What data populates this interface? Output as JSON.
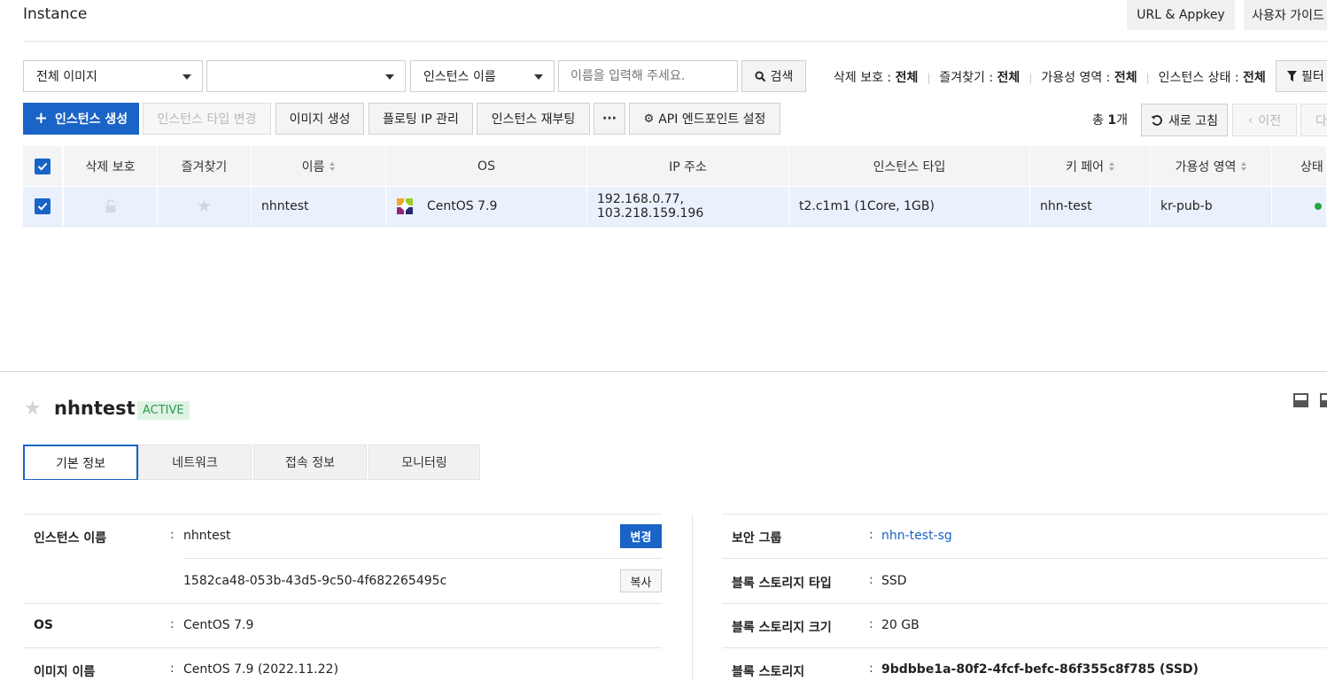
{
  "header": {
    "title": "Instance",
    "url_appkey": "URL & Appkey",
    "user_guide": "사용자 가이드"
  },
  "search": {
    "image_select": "전체 이미지",
    "second_select": "",
    "field_select": "인스턴스 이름",
    "placeholder": "이름을 입력해 주세요.",
    "search_button": "검색"
  },
  "filters": {
    "delete_protect_label": "삭제 보호 :",
    "delete_protect_value": "전체",
    "favorite_label": "즐겨찾기 :",
    "favorite_value": "전체",
    "zone_label": "가용성 영역 :",
    "zone_value": "전체",
    "state_label": "인스턴스 상태 :",
    "state_value": "전체",
    "filter_button": "필터"
  },
  "toolbar": {
    "create": "인스턴스 생성",
    "change_type": "인스턴스 타입 변경",
    "create_image": "이미지 생성",
    "floating_ip": "플로팅 IP 관리",
    "reboot": "인스턴스 재부팅",
    "more": "···",
    "api_endpoint": "API 엔드포인트 설정",
    "total_prefix": "총",
    "total_count": "1",
    "total_suffix": "개",
    "refresh": "새로 고침",
    "prev": "이전",
    "next": "다"
  },
  "table": {
    "headers": {
      "delete_protect": "삭제 보호",
      "favorite": "즐겨찾기",
      "name": "이름",
      "os": "OS",
      "ip": "IP 주소",
      "type": "인스턴스 타입",
      "keypair": "키 페어",
      "zone": "가용성 영역",
      "state": "상태"
    },
    "rows": [
      {
        "name": "nhntest",
        "os": "CentOS 7.9",
        "ip": "192.168.0.77, 103.218.159.196",
        "type": "t2.c1m1 (1Core, 1GB)",
        "keypair": "nhn-test",
        "zone": "kr-pub-b",
        "state_color": "#22a845"
      }
    ]
  },
  "detail": {
    "name": "nhntest",
    "status": "ACTIVE",
    "tabs": [
      "기본 정보",
      "네트워크",
      "접속 정보",
      "모니터링"
    ],
    "left": {
      "instance_name_label": "인스턴스 이름",
      "instance_name": "nhntest",
      "change_button": "변경",
      "instance_id": "1582ca48-053b-43d5-9c50-4f682265495c",
      "copy_button": "복사",
      "os_label": "OS",
      "os_value": "CentOS 7.9",
      "image_label": "이미지 이름",
      "image_value": "CentOS 7.9 (2022.11.22)"
    },
    "right": {
      "security_group_label": "보안 그룹",
      "security_group": "nhn-test-sg",
      "storage_type_label": "블록 스토리지 타입",
      "storage_type": "SSD",
      "storage_size_label": "블록 스토리지 크기",
      "storage_size": "20 GB",
      "storage_label": "블록 스토리지",
      "storage_value": "9bdbbe1a-80f2-4fcf-befc-86f355c8f785 (SSD)"
    }
  },
  "colors": {
    "primary": "#1a63c7",
    "status_bg": "#dff3e4",
    "status_text": "#2e9a4f"
  }
}
